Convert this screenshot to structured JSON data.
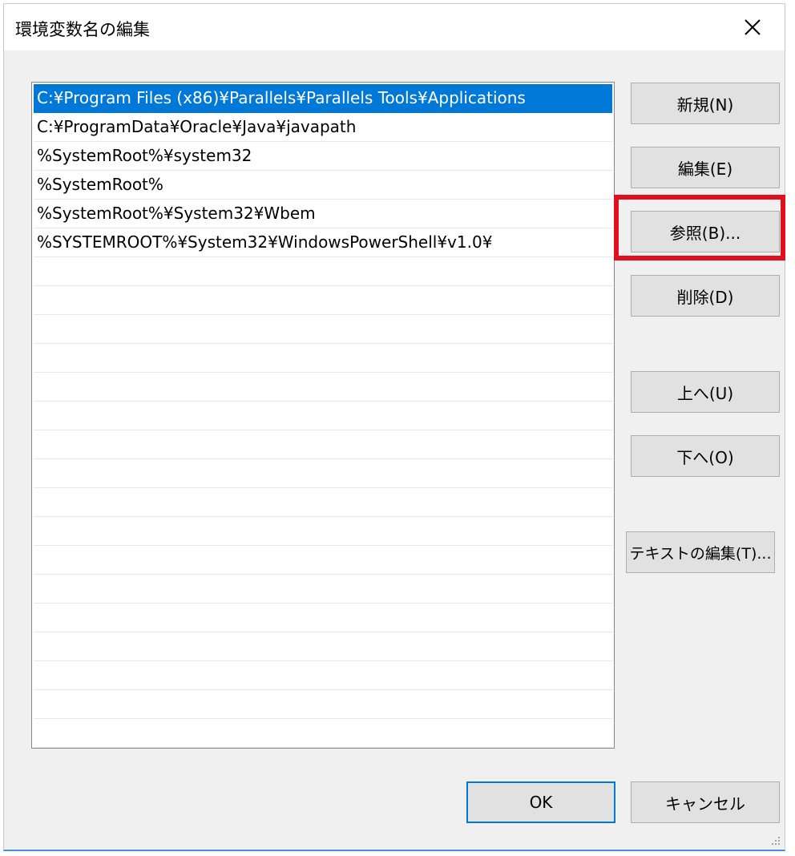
{
  "window": {
    "title": "環境変数名の編集"
  },
  "list": {
    "items": [
      "C:¥Program Files (x86)¥Parallels¥Parallels Tools¥Applications",
      "C:¥ProgramData¥Oracle¥Java¥javapath",
      "%SystemRoot%¥system32",
      "%SystemRoot%",
      "%SystemRoot%¥System32¥Wbem",
      "%SYSTEMROOT%¥System32¥WindowsPowerShell¥v1.0¥"
    ],
    "selected_index": 0
  },
  "buttons": {
    "new_label": "新規(N)",
    "edit_label": "編集(E)",
    "browse_label": "参照(B)...",
    "delete_label": "削除(D)",
    "up_label": "上へ(U)",
    "down_label": "下へ(O)",
    "edit_text_label": "テキストの編集(T)...",
    "ok_label": "OK",
    "cancel_label": "キャンセル"
  },
  "colors": {
    "selection": "#0078d7",
    "highlight": "#e0101e",
    "dialog_bg": "#f0f0f0"
  }
}
